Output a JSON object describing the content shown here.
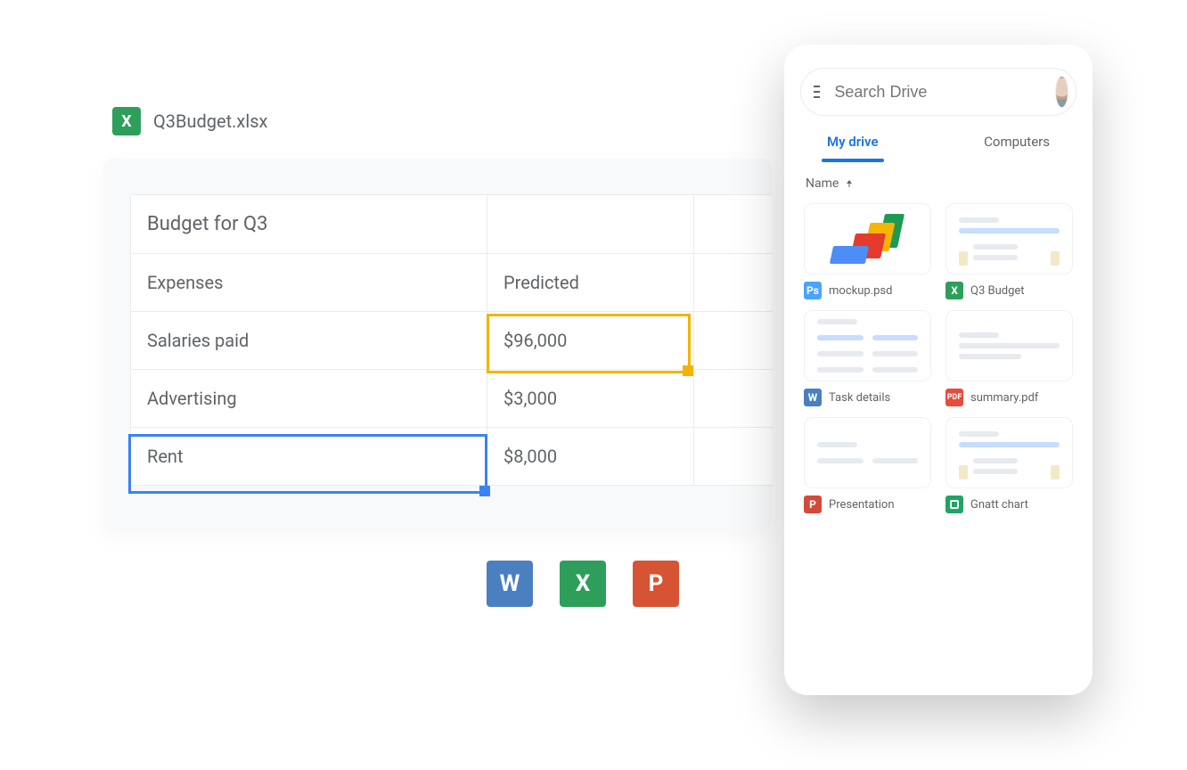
{
  "file": {
    "name": "Q3Budget.xlsx",
    "icon_name": "excel-icon",
    "icon_letter": "X"
  },
  "sheet": {
    "rows": [
      {
        "a": "Budget for Q3",
        "b": "",
        "title": true
      },
      {
        "a": "Expenses",
        "b": "Predicted"
      },
      {
        "a": "Salaries paid",
        "b": "$96,000"
      },
      {
        "a": "Advertising",
        "b": "$3,000"
      },
      {
        "a": "Rent",
        "b": "$8,000"
      }
    ],
    "highlight_yellow": {
      "row": 2,
      "col": 1
    },
    "highlight_blue": {
      "row": 4,
      "col": 0
    }
  },
  "apps": {
    "word": {
      "letter": "W",
      "color": "#4a7fc0"
    },
    "excel": {
      "letter": "X",
      "color": "#2e9e5b"
    },
    "ppt": {
      "letter": "P",
      "color": "#d65433"
    }
  },
  "drive": {
    "search_placeholder": "Search Drive",
    "tabs": [
      "My drive",
      "Computers"
    ],
    "active_tab": 0,
    "list_header": "Name",
    "sort_dir": "asc",
    "items": [
      {
        "label": "mockup.psd",
        "type": "psd"
      },
      {
        "label": "Q3 Budget",
        "type": "xlsx"
      },
      {
        "label": "Task details",
        "type": "docx"
      },
      {
        "label": "summary.pdf",
        "type": "pdf"
      },
      {
        "label": "Presentation",
        "type": "pptx"
      },
      {
        "label": "Gnatt chart",
        "type": "gsheet"
      }
    ],
    "icon_letters": {
      "psd": "Ps",
      "xlsx": "X",
      "docx": "W",
      "pdf": "PDF",
      "pptx": "P",
      "gsheet": "▦"
    }
  }
}
